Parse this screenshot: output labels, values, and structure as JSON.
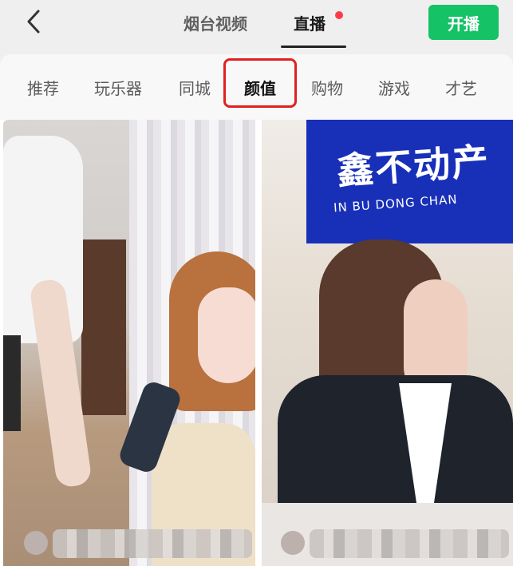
{
  "header": {
    "tabs": [
      {
        "label": "烟台视频"
      },
      {
        "label": "直播"
      }
    ],
    "start_live_label": "开播"
  },
  "categories": [
    {
      "label": "推荐"
    },
    {
      "label": "玩乐器"
    },
    {
      "label": "同城"
    },
    {
      "label": "颜值"
    },
    {
      "label": "购物"
    },
    {
      "label": "游戏"
    },
    {
      "label": "才艺"
    }
  ],
  "active_category": "颜值",
  "live_cards": [
    {
      "banner_title": "",
      "banner_subtitle": ""
    },
    {
      "banner_title": "鑫不动产",
      "banner_subtitle": "IN BU DONG CHAN"
    }
  ],
  "colors": {
    "accent_green": "#15c266",
    "highlight_red": "#e02020",
    "notification_red": "#ff3b4a",
    "banner_blue": "#1830b8"
  }
}
